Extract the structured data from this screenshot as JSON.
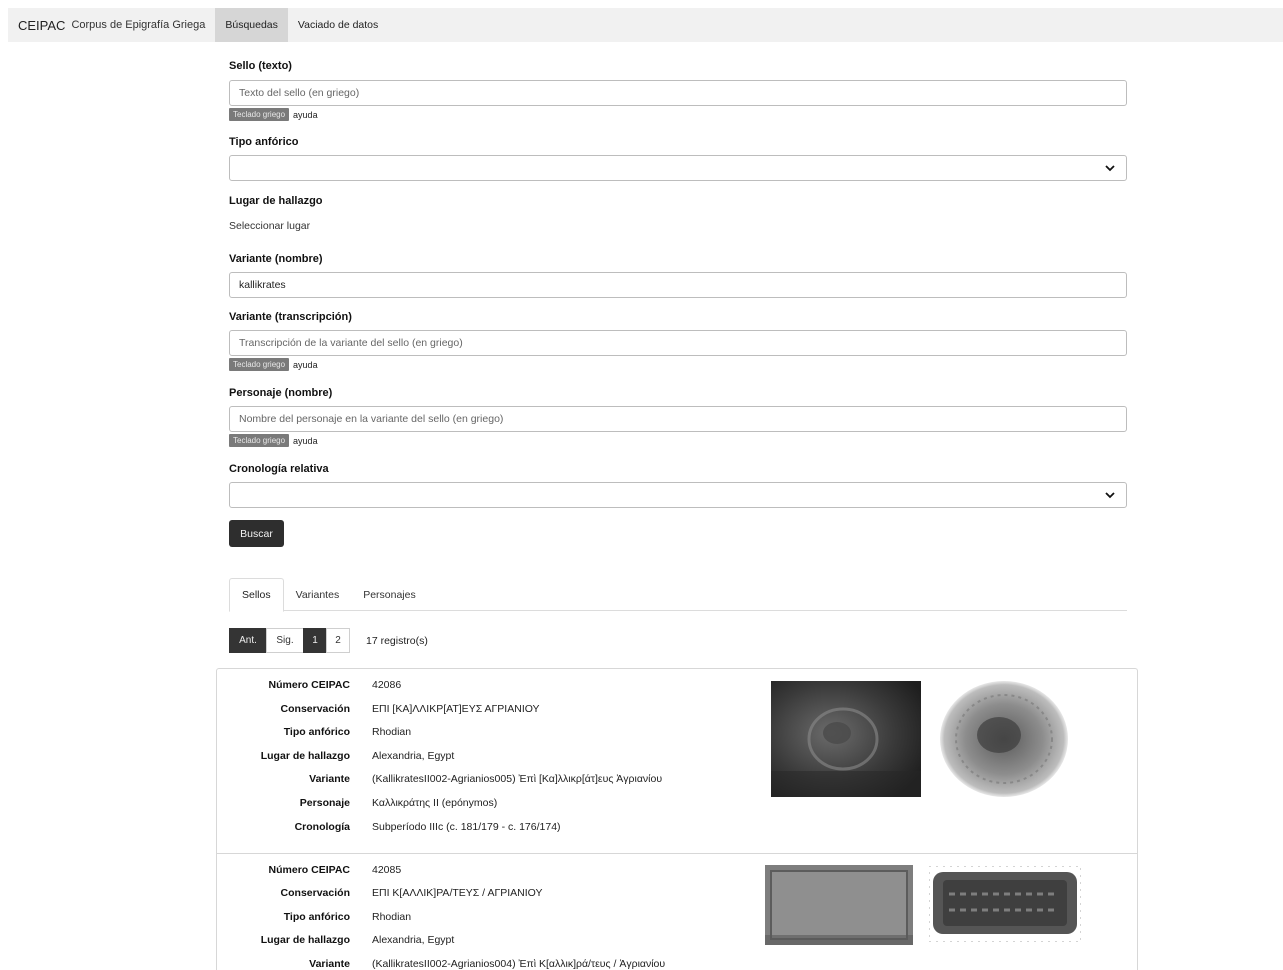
{
  "navbar": {
    "brand": "CEIPAC",
    "brand_sub": "Corpus de Epigrafía Griega",
    "tabs": [
      "Búsquedas",
      "Vaciado de datos"
    ]
  },
  "form": {
    "sello_label": "Sello (texto)",
    "sello_placeholder": "Texto del sello (en griego)",
    "kbd_label": "Teclado griego",
    "help_label": "ayuda",
    "tipo_label": "Tipo anfórico",
    "tipo_value": "",
    "lugar_label": "Lugar de hallazgo",
    "lugar_link": "Seleccionar lugar",
    "variante_nombre_label": "Variante (nombre)",
    "variante_nombre_value": "kallikrates",
    "variante_trans_label": "Variante (transcripción)",
    "variante_trans_placeholder": "Transcripción de la variante del sello (en griego)",
    "personaje_label": "Personaje (nombre)",
    "personaje_placeholder": "Nombre del personaje en la variante del sello (en griego)",
    "crono_label": "Cronología relativa",
    "crono_value": "",
    "search_button": "Buscar"
  },
  "result_tabs": [
    "Sellos",
    "Variantes",
    "Personajes"
  ],
  "pager": {
    "prev": "Ant.",
    "next": "Sig.",
    "pages": [
      "1",
      "2"
    ],
    "current_page": "1",
    "count_text": "17 registro(s)"
  },
  "field_labels": {
    "numero": "Número CEIPAC",
    "conservacion": "Conservación",
    "tipo": "Tipo anfórico",
    "lugar": "Lugar de hallazgo",
    "variante": "Variante",
    "personaje": "Personaje",
    "cronologia": "Cronología"
  },
  "records": [
    {
      "numero": "42086",
      "conservacion": "ΕΠΙ [ΚΑ]ΛΛΙΚΡ[ΑΤ]ΕΥΣ ΑΓΡΙΑΝΙΟΥ",
      "tipo": "Rhodian",
      "lugar": "Alexandria, Egypt",
      "variante": "(KallikratesII002-Agrianios005) Ἐπὶ [Κα]λλικρ[άτ]ευς Ἀγριανίου",
      "personaje": "Καλλικράτης II (epónymos)",
      "cronologia": "Subperíodo IIIc (c. 181/179 - c. 176/174)"
    },
    {
      "numero": "42085",
      "conservacion": "ΕΠΙ Κ[ΑΛΛΙΚ]ΡΑ/ΤΕΥΣ / ΑΓΡΙΑΝΙΟΥ",
      "tipo": "Rhodian",
      "lugar": "Alexandria, Egypt",
      "variante": "(KallikratesII002-Agrianios004) Ἐπὶ Κ[αλλικ]ρά/τευς / Ἀγριανίου"
    }
  ]
}
